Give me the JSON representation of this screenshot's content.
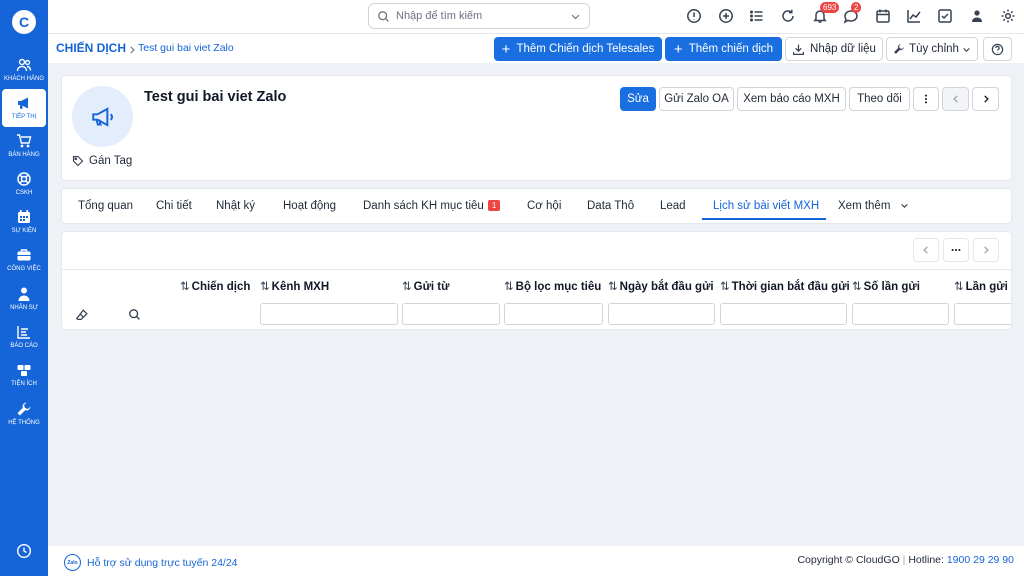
{
  "sidebar": {
    "items": [
      {
        "label": "Khách hàng",
        "icon": "users-icon"
      },
      {
        "label": "Tiếp thị",
        "icon": "megaphone-icon"
      },
      {
        "label": "Bán hàng",
        "icon": "cart-icon"
      },
      {
        "label": "CSKH",
        "icon": "support-icon"
      },
      {
        "label": "Sự kiện",
        "icon": "calendar-icon"
      },
      {
        "label": "Công việc",
        "icon": "briefcase-icon"
      },
      {
        "label": "Nhân sự",
        "icon": "person-icon"
      },
      {
        "label": "Báo cáo",
        "icon": "report-icon"
      },
      {
        "label": "Tiện ích",
        "icon": "boxes-icon"
      },
      {
        "label": "Hệ thống",
        "icon": "wrench-icon"
      }
    ]
  },
  "topbar": {
    "search_placeholder": "Nhập để tìm kiếm",
    "notifications_count": "693",
    "messages_count": "2"
  },
  "breadcrumb": {
    "root": "CHIẾN DỊCH",
    "current": "Test gui bai viet Zalo"
  },
  "actions": {
    "add_telesales": "Thêm Chiến dịch Telesales",
    "add_campaign": "Thêm chiến dịch",
    "import": "Nhập dữ liệu",
    "customize": "Tùy chỉnh"
  },
  "record": {
    "title": "Test gui bai viet Zalo",
    "tag_label": "Gán Tag",
    "edit": "Sửa",
    "send_zalo": "Gửi Zalo OA",
    "view_report": "Xem báo cáo MXH",
    "follow": "Theo dõi"
  },
  "tabs": [
    {
      "label": "Tổng quan"
    },
    {
      "label": "Chi tiết"
    },
    {
      "label": "Nhật ký"
    },
    {
      "label": "Hoạt động"
    },
    {
      "label": "Danh sách KH mục tiêu",
      "badge": "1"
    },
    {
      "label": "Cơ hội"
    },
    {
      "label": "Data Thô"
    },
    {
      "label": "Lead"
    },
    {
      "label": "Lịch sử bài viết MXH",
      "active": true
    },
    {
      "label": "Xem thêm"
    }
  ],
  "table": {
    "columns": [
      "Chiến dịch",
      "Kênh MXH",
      "Gửi từ",
      "Bộ lọc mục tiêu",
      "Ngày bắt đầu gửi",
      "Thời gian bắt đầu gửi",
      "Số lần gửi",
      "Lần gửi g"
    ],
    "sort_glyph": "⇅"
  },
  "footer": {
    "support": "Hỗ trợ sử dụng trực tuyến 24/24",
    "zalo_logo_text": "Zalo",
    "copyright": "Copyright © CloudGO",
    "hotline_label": "Hotline:",
    "hotline": "1900 29 29 90"
  },
  "colors": {
    "primary": "#1565d8",
    "badge": "#ef4444"
  }
}
